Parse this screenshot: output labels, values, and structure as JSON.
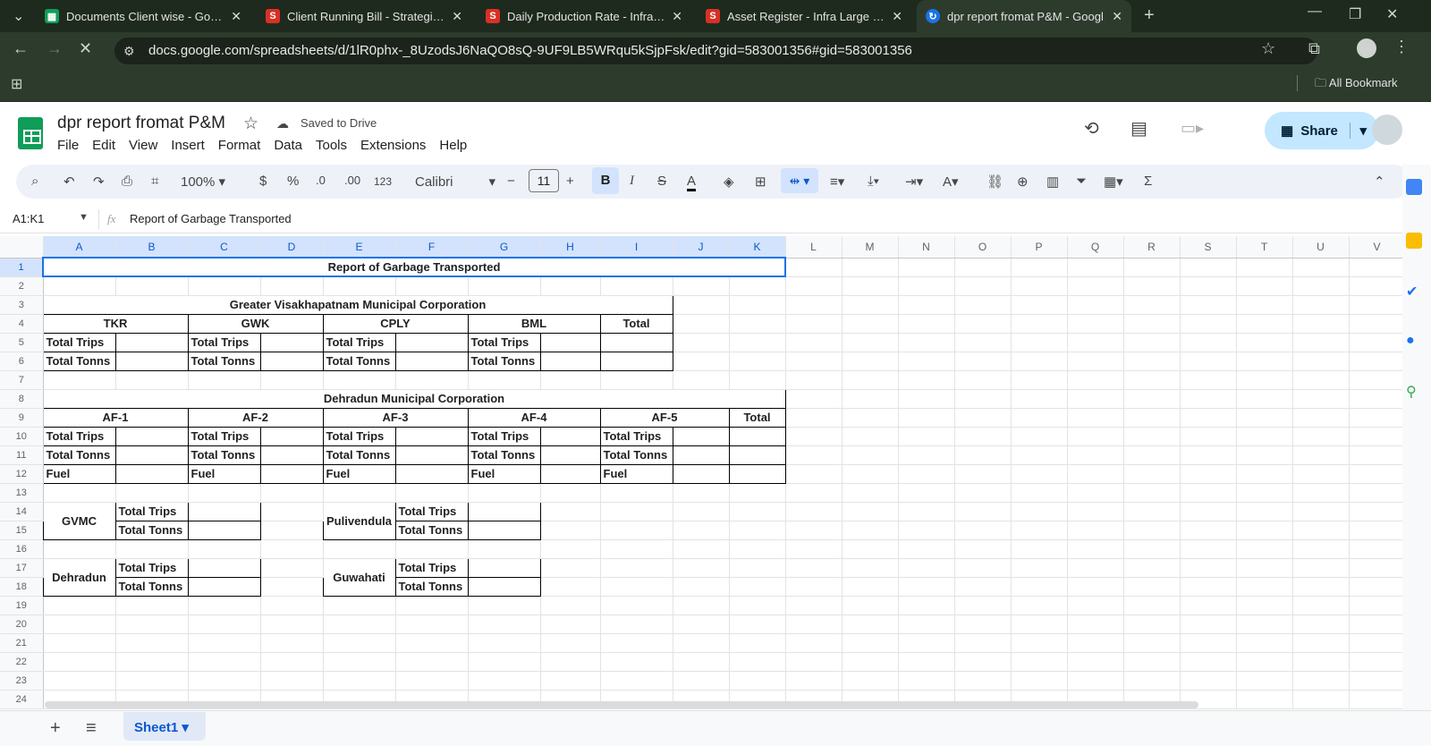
{
  "browser": {
    "tabs": [
      {
        "title": "Documents Client wise - Googl",
        "icon": "sheets"
      },
      {
        "title": "Client Running Bill - StrategicEl",
        "icon": "s"
      },
      {
        "title": "Daily Production Rate - Infra La",
        "icon": "s"
      },
      {
        "title": "Asset Register - Infra Large Use",
        "icon": "s"
      },
      {
        "title": "dpr report fromat P&M - Googl",
        "icon": "sheets",
        "active": true
      }
    ],
    "url": "docs.google.com/spreadsheets/d/1lR0phx-_8UzodsJ6NaQO8sQ-9UF9LB5WRqu5kSjpFsk/edit?gid=583001356#gid=583001356",
    "bookmarks_label": "All Bookmark"
  },
  "doc": {
    "title": "dpr report fromat P&M",
    "saved": "Saved to Drive",
    "menu": [
      "File",
      "Edit",
      "View",
      "Insert",
      "Format",
      "Data",
      "Tools",
      "Extensions",
      "Help"
    ],
    "share": "Share"
  },
  "toolbar": {
    "zoom": "100%",
    "currency": "$",
    "percent": "%",
    "dec_dec": ".0",
    "inc_dec": ".00",
    "num_fmt": "123",
    "font": "Calibri",
    "font_size": "11",
    "minus": "−",
    "plus": "+",
    "bold": "B",
    "italic": "I",
    "strike": "S",
    "textcolor": "A"
  },
  "formula": {
    "cellref": "A1:K1",
    "fx": "fx",
    "content": "Report of Garbage Transported"
  },
  "columns": [
    "A",
    "B",
    "C",
    "D",
    "E",
    "F",
    "G",
    "H",
    "I",
    "J",
    "K",
    "L",
    "M",
    "N",
    "O",
    "P",
    "Q",
    "R",
    "S",
    "T",
    "U",
    "V"
  ],
  "rows": [
    "1",
    "2",
    "3",
    "4",
    "5",
    "6",
    "7",
    "8",
    "9",
    "10",
    "11",
    "12",
    "13",
    "14",
    "15",
    "16",
    "17",
    "18",
    "19",
    "20",
    "21",
    "22",
    "23",
    "24"
  ],
  "cells": {
    "r1": "Report of Garbage Transported",
    "r3": "Greater Visakhapatnam Municipal Corporation",
    "r4": [
      "TKR",
      "GWK",
      "CPLY",
      "BML",
      "Total"
    ],
    "trips": "Total Trips",
    "tonns": "Total Tonns",
    "fuel": "Fuel",
    "r8": "Dehradun Municipal Corporation",
    "r9": [
      "AF-1",
      "AF-2",
      "AF-3",
      "AF-4",
      "AF-5",
      "Total"
    ],
    "gvmc": "GVMC",
    "pulivendula": "Pulivendula",
    "dehradun": "Dehradun",
    "guwahati": "Guwahati"
  },
  "sheet": {
    "name": "Sheet1",
    "add": "+",
    "list": "≡"
  }
}
